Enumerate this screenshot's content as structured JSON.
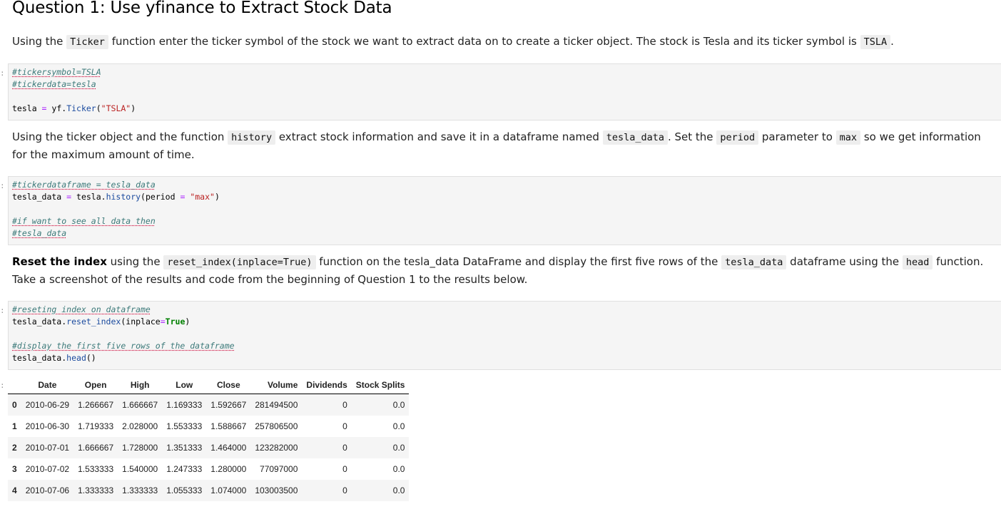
{
  "heading": "Question 1: Use yfinance to Extract Stock Data",
  "p1": {
    "t1": "Using the ",
    "c1": "Ticker",
    "t2": " function enter the ticker symbol of the stock we want to extract data on to create a ticker object. The stock is Tesla and its ticker symbol is ",
    "c2": "TSLA",
    "t3": "."
  },
  "cell1": {
    "prompt": ":",
    "l1": "#tickersymbol=TSLA",
    "l2": "#tickerdata=tesla",
    "l3a": "tesla ",
    "l3op": "=",
    "l3b": " yf.",
    "l3fn": "Ticker",
    "l3c": "(",
    "l3str": "\"TSLA\"",
    "l3d": ")"
  },
  "p2": {
    "t1": "Using the ticker object and the function ",
    "c1": "history",
    "t2": " extract stock information and save it in a dataframe named ",
    "c2": "tesla_data",
    "t3": ". Set the ",
    "c3": "period",
    "t4": " parameter to ",
    "c4": "max",
    "t5": " so we get information for the maximum amount of time."
  },
  "cell2": {
    "prompt": ":",
    "l1": "#tickerdataframe = tesla_data",
    "l2a": "tesla_data ",
    "l2op": "=",
    "l2b": " tesla.",
    "l2fn": "history",
    "l2c": "(period ",
    "l2op2": "=",
    "l2d": " ",
    "l2str": "\"max\"",
    "l2e": ")",
    "l3": "#if want to see all data then",
    "l4": "#tesla_data"
  },
  "p3": {
    "bold": "Reset the index",
    "t1": " using the ",
    "c1": "reset_index(inplace=True)",
    "t2": " function on the tesla_data DataFrame and display the first five rows of the ",
    "c2": "tesla_data",
    "t3": " dataframe using the ",
    "c3": "head",
    "t4": " function. Take a screenshot of the results and code from the beginning of Question 1 to the results below."
  },
  "cell3": {
    "prompt": ":",
    "l1": "#reseting index on dataframe",
    "l2a": "tesla_data.",
    "l2fn": "reset_index",
    "l2b": "(inplace",
    "l2op": "=",
    "l2kw": "True",
    "l2c": ")",
    "l3": "#display the first five rows of the dataframe",
    "l4a": "tesla_data.",
    "l4fn": "head",
    "l4b": "()"
  },
  "output": {
    "prompt": ":",
    "columns": [
      "",
      "Date",
      "Open",
      "High",
      "Low",
      "Close",
      "Volume",
      "Dividends",
      "Stock Splits"
    ],
    "rows": [
      [
        "0",
        "2010-06-29",
        "1.266667",
        "1.666667",
        "1.169333",
        "1.592667",
        "281494500",
        "0",
        "0.0"
      ],
      [
        "1",
        "2010-06-30",
        "1.719333",
        "2.028000",
        "1.553333",
        "1.588667",
        "257806500",
        "0",
        "0.0"
      ],
      [
        "2",
        "2010-07-01",
        "1.666667",
        "1.728000",
        "1.351333",
        "1.464000",
        "123282000",
        "0",
        "0.0"
      ],
      [
        "3",
        "2010-07-02",
        "1.533333",
        "1.540000",
        "1.247333",
        "1.280000",
        "77097000",
        "0",
        "0.0"
      ],
      [
        "4",
        "2010-07-06",
        "1.333333",
        "1.333333",
        "1.055333",
        "1.074000",
        "103003500",
        "0",
        "0.0"
      ]
    ]
  }
}
